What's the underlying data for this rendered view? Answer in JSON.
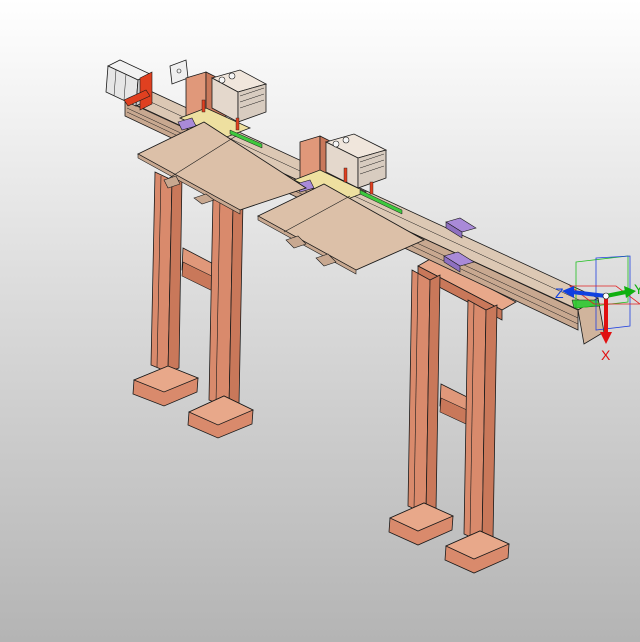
{
  "viewport": {
    "background_top": "#ffffff",
    "background_bottom": "#b4b4b4"
  },
  "model": {
    "part_color": "#e8a88a",
    "part_shadow": "#c9785a",
    "edge_color": "#1a1a1a",
    "plate_color": "#dcc0a8",
    "rail_color": "#d8c4b0",
    "bracket_color": "#a98ad8",
    "accent_green": "#3ec83e",
    "accent_red": "#e04020",
    "motor_color": "#e6e6e6"
  },
  "triad": {
    "x_label": "X",
    "y_label": "Y",
    "z_label": "Z",
    "x_color": "#e01010",
    "y_color": "#10b010",
    "z_color": "#1040e0",
    "plane_green": "#20c020",
    "plane_blue": "#2040e0",
    "plane_red": "#e02020"
  }
}
